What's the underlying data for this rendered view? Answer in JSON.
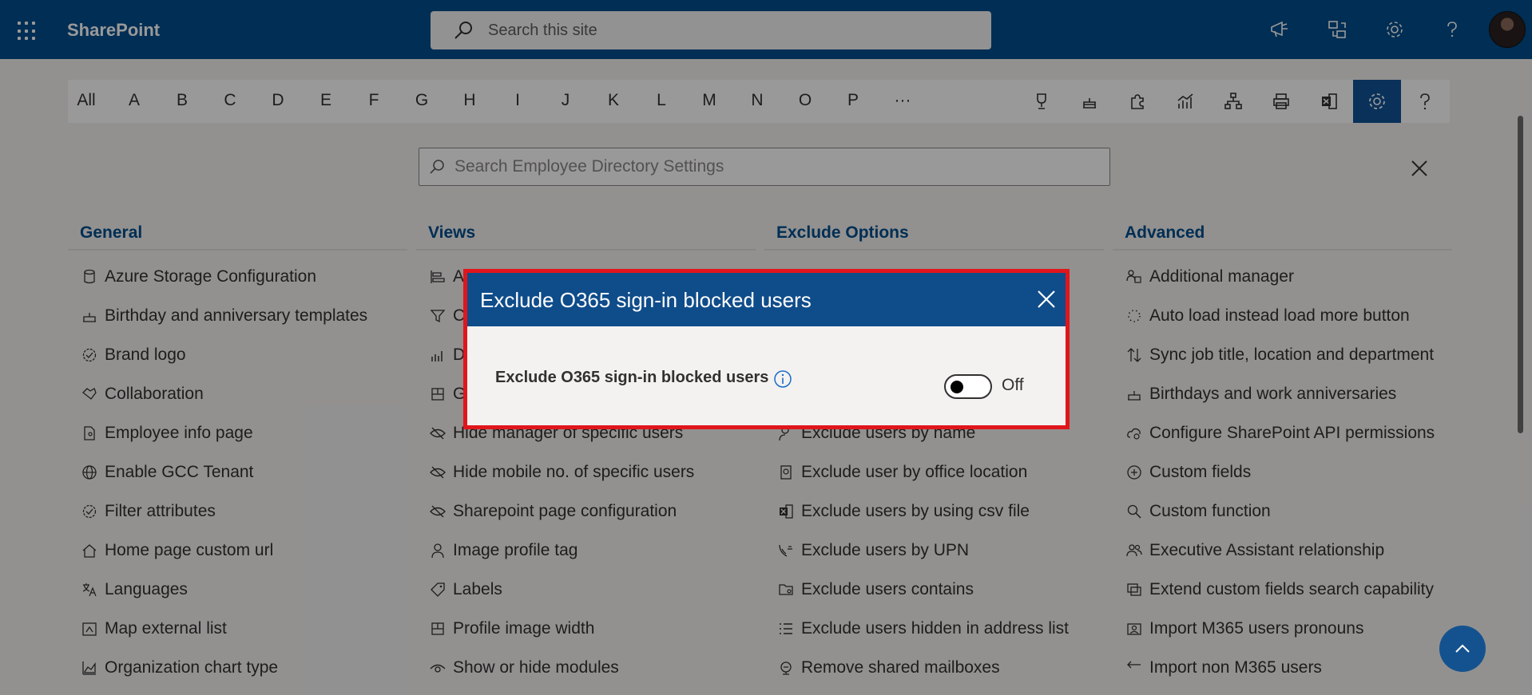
{
  "topbar": {
    "brand": "SharePoint",
    "search_placeholder": "Search this site"
  },
  "letters": [
    "All",
    "A",
    "B",
    "C",
    "D",
    "E",
    "F",
    "G",
    "H",
    "I",
    "J",
    "K",
    "L",
    "M",
    "N",
    "O",
    "P",
    "···"
  ],
  "toolbar_icons": [
    "trophy-icon",
    "cake-icon",
    "puzzle-icon",
    "chart-icon",
    "org-chart-icon",
    "print-icon",
    "excel-icon",
    "settings-icon",
    "help-icon"
  ],
  "settings_search_placeholder": "Search Employee Directory Settings",
  "columns": [
    {
      "title": "General",
      "items": [
        "Azure Storage Configuration",
        "Birthday and anniversary templates",
        "Brand logo",
        "Collaboration",
        "Employee info page",
        "Enable GCC Tenant",
        "Filter attributes",
        "Home page custom url",
        "Languages",
        "Map external list",
        "Organization chart type"
      ]
    },
    {
      "title": "Views",
      "items": [
        "A",
        "C",
        "D",
        "G",
        "Hide manager of specific users",
        "Hide mobile no. of specific users",
        "Sharepoint page configuration",
        "Image profile tag",
        "Labels",
        "Profile image width",
        "Show or hide modules"
      ]
    },
    {
      "title": "Exclude Options",
      "items": [
        "",
        "",
        "",
        "",
        "Exclude users by name",
        "Exclude user by office location",
        "Exclude users by using csv file",
        "Exclude users by UPN",
        "Exclude users contains",
        "Exclude users hidden in address list",
        "Remove shared mailboxes"
      ]
    },
    {
      "title": "Advanced",
      "items": [
        "Additional manager",
        "Auto load instead load more button",
        "Sync job title, location and department",
        "Birthdays and work anniversaries",
        "Configure SharePoint API permissions",
        "Custom fields",
        "Custom function",
        "Executive Assistant relationship",
        "Extend custom fields search capability",
        "Import M365 users pronouns",
        "Import non M365 users"
      ]
    }
  ],
  "dialog": {
    "title": "Exclude O365 sign-in blocked users",
    "label": "Exclude O365 sign-in blocked users",
    "toggle_state": "Off"
  }
}
